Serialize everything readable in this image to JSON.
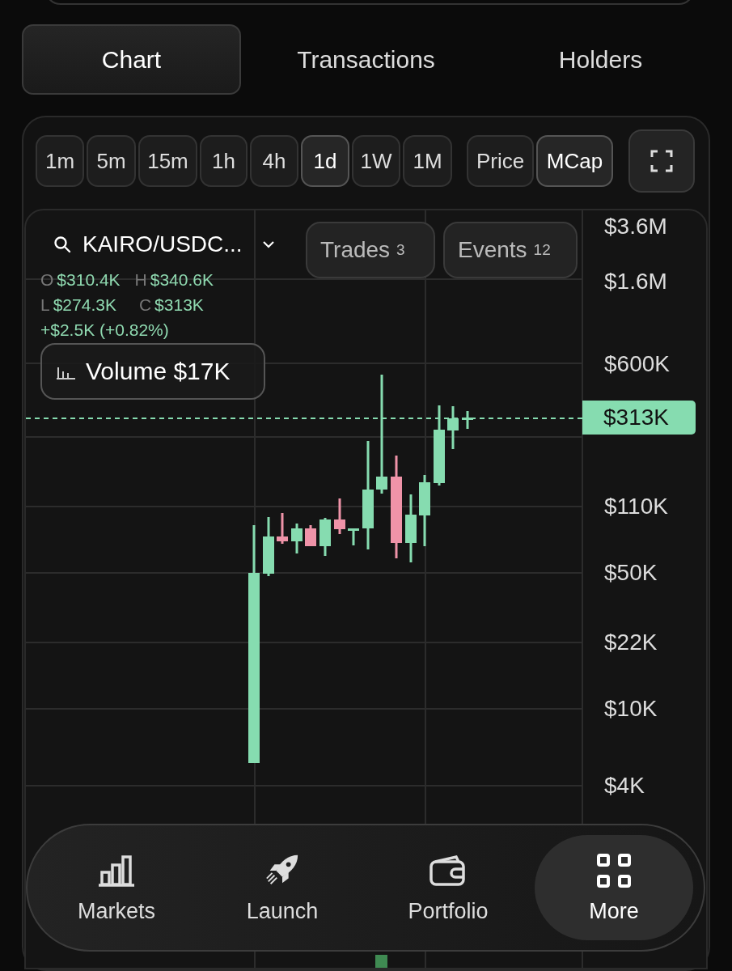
{
  "tabs": [
    {
      "label": "Chart",
      "selected": true
    },
    {
      "label": "Transactions",
      "selected": false
    },
    {
      "label": "Holders",
      "selected": false
    }
  ],
  "intervals": [
    {
      "label": "1m",
      "selected": false
    },
    {
      "label": "5m",
      "selected": false
    },
    {
      "label": "15m",
      "selected": false
    },
    {
      "label": "1h",
      "selected": false
    },
    {
      "label": "4h",
      "selected": false
    },
    {
      "label": "1d",
      "selected": true
    },
    {
      "label": "1W",
      "selected": false
    },
    {
      "label": "1M",
      "selected": false
    }
  ],
  "modes": [
    {
      "label": "Price",
      "selected": false
    },
    {
      "label": "MCap",
      "selected": true
    }
  ],
  "chart": {
    "pair": "KAIRO/USDC...",
    "trades": {
      "label": "Trades",
      "count": "3"
    },
    "events": {
      "label": "Events",
      "count": "12"
    },
    "ohlc": [
      {
        "key": "O",
        "value": "$310.4K"
      },
      {
        "key": "H",
        "value": "$340.6K"
      },
      {
        "key": "L",
        "value": "$274.3K"
      },
      {
        "key": "C",
        "value": "$313K"
      }
    ],
    "change": "+$2.5K (+0.82%)",
    "volume": "Volume $17K",
    "price_axis": [
      "$3.6M",
      "$1.6M",
      "$600K",
      "$110K",
      "$50K",
      "$22K",
      "$10K",
      "$4K"
    ],
    "last_price": "$313K"
  },
  "nav": [
    {
      "label": "Markets",
      "selected": false
    },
    {
      "label": "Launch",
      "selected": false
    },
    {
      "label": "Portfolio",
      "selected": false
    },
    {
      "label": "More",
      "selected": true
    }
  ]
}
